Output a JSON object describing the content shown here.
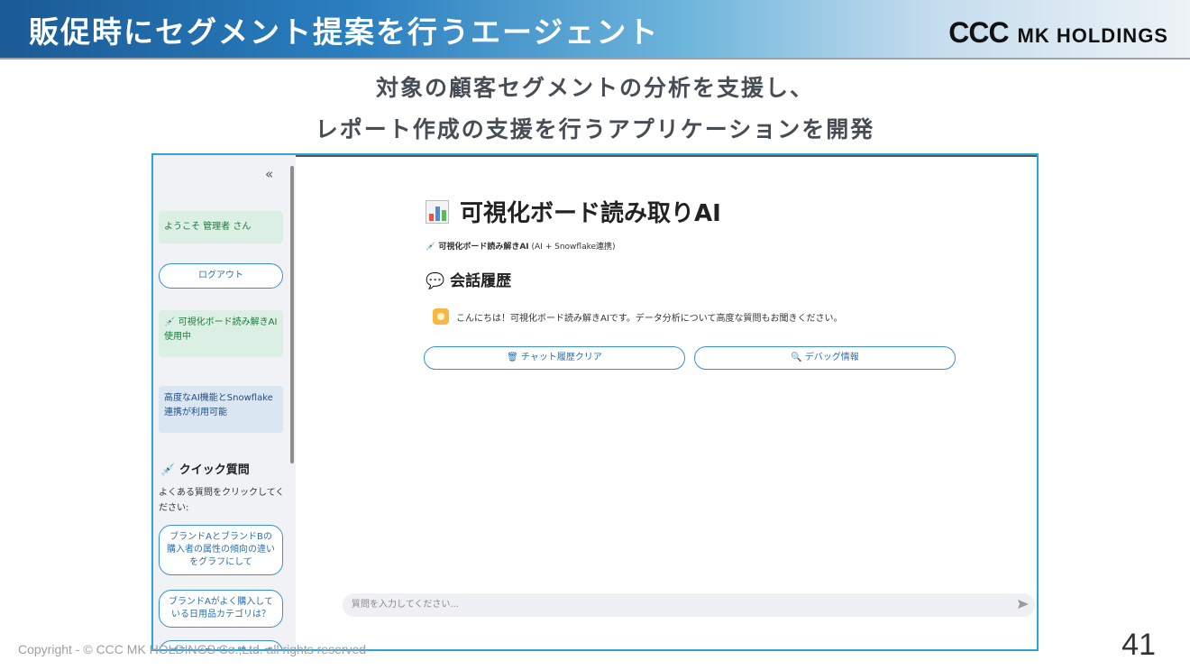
{
  "header": {
    "title": "販促時にセグメント提案を行うエージェント",
    "logo_ccc": "CCC",
    "logo_mk": "MK HOLDINGS"
  },
  "subtitle": {
    "line1": "対象の顧客セグメントの分析を支援し、",
    "line2": "レポート作成の支援を行うアプリケーションを開発"
  },
  "app": {
    "sidebar": {
      "collapse": "«",
      "welcome": "ようこそ 管理者 さん",
      "logout": "ログアウト",
      "status_in_use": "💉 可視化ボード読み解きAI使用中",
      "status_features": "高度なAI機能とSnowflake連携が利用可能",
      "quick_title": "💉 クイック質問",
      "quick_desc": "よくある質問をクリックしてください:",
      "quick_items": [
        "ブランドAとブランドBの購入者の属性の傾向の違いをグラフにして",
        "ブランドAがよく購入している日用品カテゴリは？",
        "ブランドBがよく購入して"
      ]
    },
    "main": {
      "title": "可視化ボード読み取りAI",
      "subtitle_bold": "💉 可視化ボード読み解きAI",
      "subtitle_rest": "(AI + Snowflake連携)",
      "history_title": "会話履歴",
      "message": "こんにちは！可視化ボード読み解きAIです。データ分析について高度な質問もお聞きください。",
      "clear_button": "🗑 チャット履歴クリア",
      "debug_button": "🔍 デバッグ情報",
      "input_placeholder": "質問を入力してください..."
    }
  },
  "footer": {
    "copyright": "Copyright - © CCC MK HOLDINGS Co.,Ltd. all rights reserved",
    "page_number": "41"
  },
  "colors": {
    "header_start": "#1a5a95",
    "frame_border": "#2aa7d8",
    "button_border": "#3a8fd0"
  }
}
